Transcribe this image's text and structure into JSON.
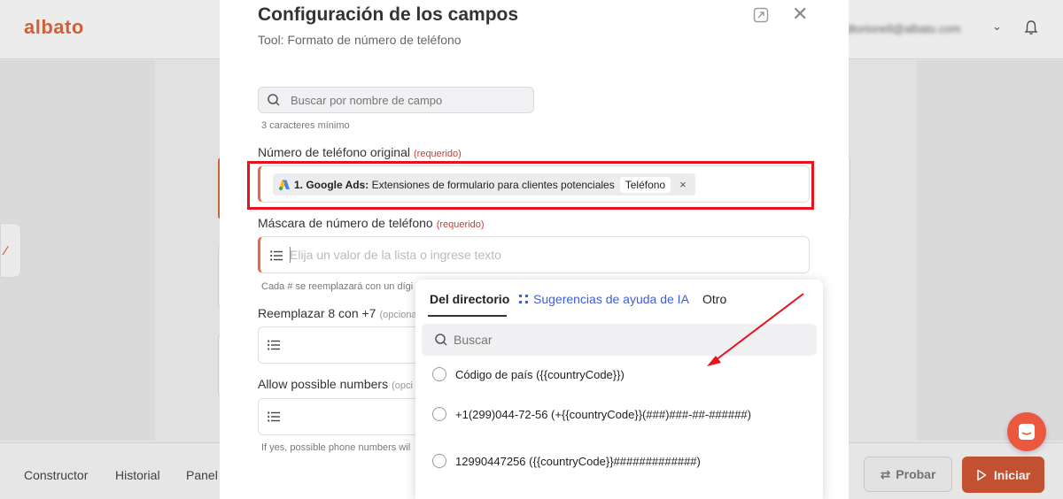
{
  "app": {
    "logo": "albato",
    "user_email": "dtorionell@albato.com"
  },
  "bottom_nav": {
    "items": [
      "Constructor",
      "Historial",
      "Panel"
    ],
    "probar_label": "Probar",
    "iniciar_label": "Iniciar"
  },
  "modal": {
    "title": "Configuración de los campos",
    "subtitle": "Tool: Formato de número de teléfono",
    "search": {
      "placeholder": "Buscar por nombre de campo",
      "hint": "3 caracteres mínimo"
    },
    "fields": [
      {
        "label": "Número de teléfono original",
        "badge": "(requerido)",
        "chip": {
          "source": "1. Google Ads:",
          "description": "Extensiones de formulario para clientes potenciales",
          "tag": "Teléfono",
          "remove": "×"
        }
      },
      {
        "label": "Máscara de número de teléfono",
        "badge": "(requerido)",
        "placeholder": "Elija un valor de la lista o ingrese texto",
        "hint": "Cada # se reemplazará con un dígi"
      },
      {
        "label": "Reemplazar 8 con +7",
        "badge": "(opciona"
      },
      {
        "label": "Allow possible numbers",
        "badge": "(opci",
        "hint": "If yes, possible phone numbers wil"
      }
    ]
  },
  "dropdown": {
    "tabs": [
      "Del directorio",
      "Sugerencias de ayuda de IA",
      "Otro"
    ],
    "active_tab": "Del directorio",
    "search_placeholder": "Buscar",
    "options": [
      "Código de país ({{countryCode}})",
      "+1(299)044-72-56 (+{{countryCode}}(###)###-##-######)",
      "12990447256 ({{countryCode}}#############)"
    ]
  },
  "colors": {
    "brand": "#d8643f",
    "highlight_frame": "#e5131f",
    "ai_tab": "#3c5fd8",
    "required": "#d0392e",
    "iniciar_button": "#c95534"
  }
}
